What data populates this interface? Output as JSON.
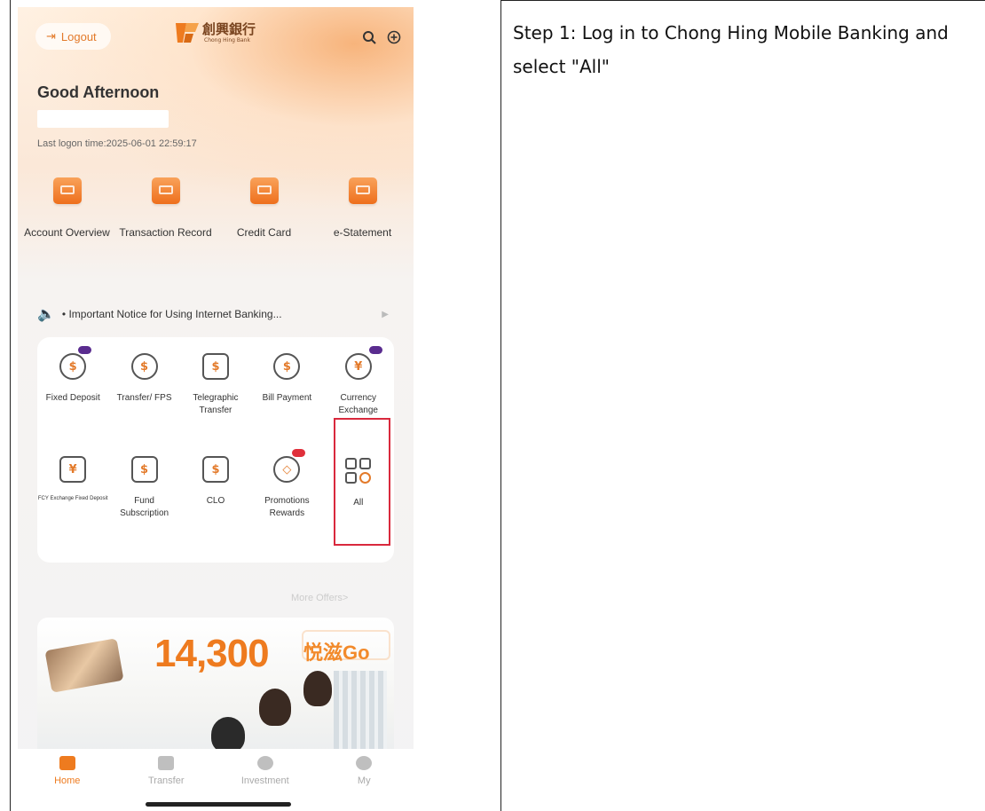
{
  "instruction": {
    "text": "Step 1: Log in to Chong Hing Mobile Banking and select \"All\""
  },
  "app": {
    "header": {
      "logout_label": "Logout",
      "logout_icon": "logout-icon",
      "brand_name": "創興銀行",
      "brand_sub": "Chong Hing Bank",
      "search_icon": "search-icon",
      "add_icon": "plus-circle-icon"
    },
    "greeting": "Good Afternoon",
    "last_logon": "Last logon time:2025-06-01 22:59:17",
    "quick_access": [
      {
        "label": "Account Overview",
        "icon": "wallet-icon"
      },
      {
        "label": "Transaction Record",
        "icon": "receipt-icon"
      },
      {
        "label": "Credit Card",
        "icon": "credit-card-icon"
      },
      {
        "label": "e-Statement",
        "icon": "statement-icon"
      }
    ],
    "notice": {
      "text": "• Important Notice for Using Internet Banking...",
      "icon": "speaker-icon"
    },
    "services": [
      {
        "label": "Fixed Deposit",
        "icon": "fixed-deposit-icon",
        "badge": "purple"
      },
      {
        "label": "Transfer/ FPS",
        "icon": "transfer-icon"
      },
      {
        "label": "Telegraphic Transfer",
        "icon": "telegraphic-transfer-icon"
      },
      {
        "label": "Bill Payment",
        "icon": "bill-payment-icon"
      },
      {
        "label": "Currency Exchange",
        "icon": "currency-exchange-icon",
        "badge": "purple"
      },
      {
        "label": "FCY Exchange Fixed Deposit",
        "icon": "fcy-deposit-icon"
      },
      {
        "label": "Fund Subscription",
        "icon": "fund-icon"
      },
      {
        "label": "CLO",
        "icon": "clo-icon"
      },
      {
        "label": "Promotions Rewards",
        "icon": "promotion-tag-icon",
        "badge": "red"
      },
      {
        "label": "All",
        "icon": "all-grid-icon"
      }
    ],
    "more_offers": "More Offers>",
    "banner": {
      "points": "14,300",
      "tag": "悦滋Go"
    },
    "bottom_nav": [
      {
        "label": "Home",
        "icon": "home-icon",
        "active": true
      },
      {
        "label": "Transfer",
        "icon": "transfer-nav-icon"
      },
      {
        "label": "Investment",
        "icon": "investment-icon"
      },
      {
        "label": "My",
        "icon": "profile-icon"
      }
    ],
    "colors": {
      "accent": "#ee7b1f",
      "highlight": "#d9293d",
      "badge": "#5a2c8f"
    }
  }
}
